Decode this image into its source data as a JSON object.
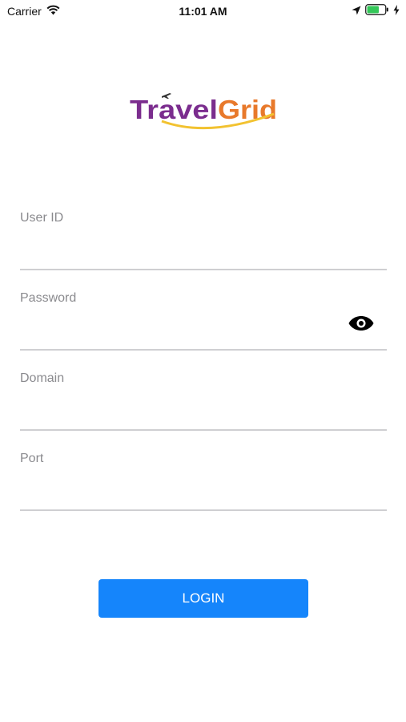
{
  "status_bar": {
    "carrier": "Carrier",
    "time": "11:01 AM"
  },
  "logo": {
    "text_part1": "Travel",
    "text_part2": "Grid",
    "color_purple": "#7b2d8e",
    "color_orange": "#e8792b",
    "swoosh_color": "#f2c230"
  },
  "form": {
    "user_id_label": "User ID",
    "password_label": "Password",
    "domain_label": "Domain",
    "port_label": "Port",
    "user_id_value": "",
    "password_value": "",
    "domain_value": "",
    "port_value": ""
  },
  "login": {
    "label": "LOGIN",
    "color": "#1585fb"
  }
}
